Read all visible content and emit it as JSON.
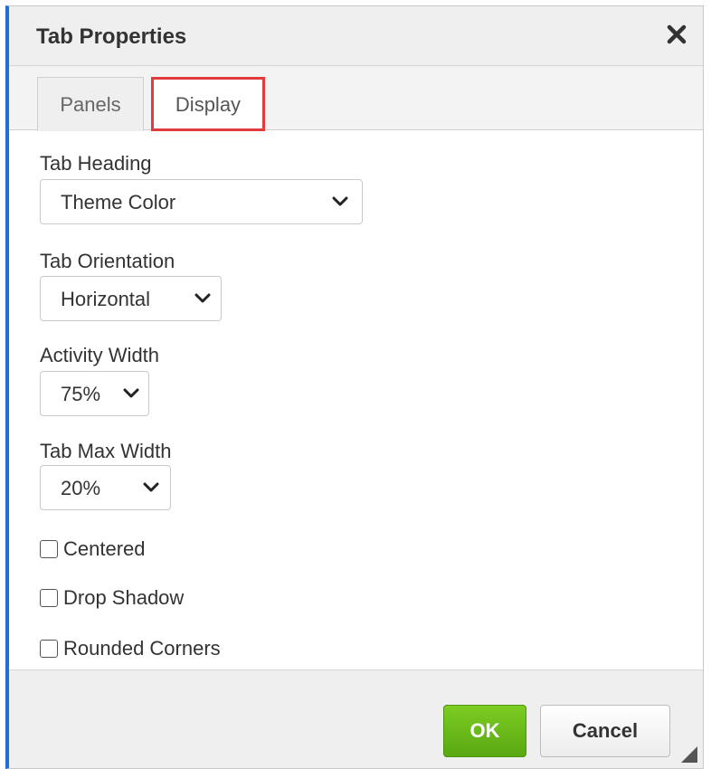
{
  "dialog": {
    "title": "Tab Properties",
    "close_icon": "close-icon"
  },
  "tabs": [
    {
      "label": "Panels",
      "active": false
    },
    {
      "label": "Display",
      "active": true
    }
  ],
  "fields": {
    "tab_heading": {
      "label": "Tab Heading",
      "value": "Theme Color"
    },
    "tab_orientation": {
      "label": "Tab Orientation",
      "value": "Horizontal"
    },
    "activity_width": {
      "label": "Activity Width",
      "value": "75%"
    },
    "tab_max_width": {
      "label": "Tab Max Width",
      "value": "20%"
    }
  },
  "checkboxes": [
    {
      "label": "Centered",
      "checked": false
    },
    {
      "label": "Drop Shadow",
      "checked": false
    },
    {
      "label": "Rounded Corners",
      "checked": false
    }
  ],
  "footer": {
    "ok_label": "OK",
    "cancel_label": "Cancel"
  },
  "colors": {
    "accent_border": "#1f6fd6",
    "active_tab_highlight": "#e23b3b",
    "ok_button": "#6ab91a"
  }
}
